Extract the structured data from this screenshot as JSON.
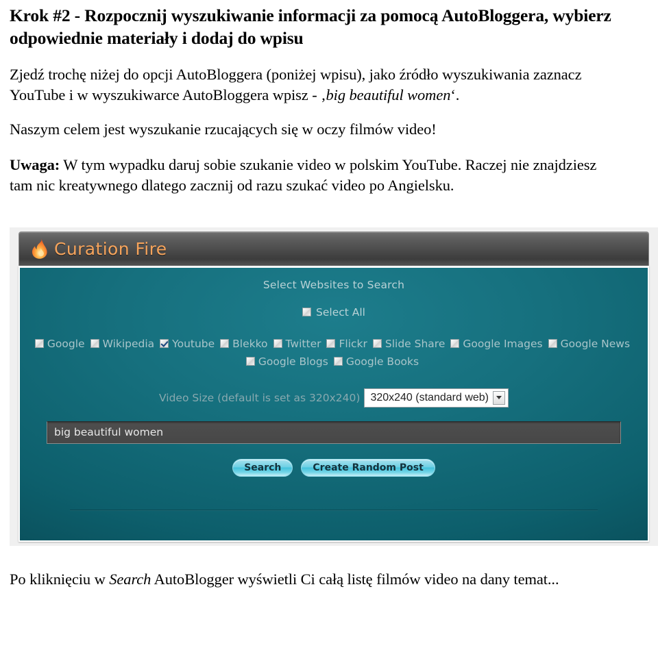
{
  "document": {
    "headline": "Krok #2 - Rozpocznij wyszukiwanie informacji za pomocą AutoBloggera, wybierz odpowiednie materiały i dodaj do wpisu",
    "para1_part1": "Zjedź trochę niżej do opcji AutoBloggera (poniżej wpisu), jako źródło wyszukiwania zaznacz YouTube i w wyszukiwarce AutoBloggera wpisz - ‚",
    "para1_italic": "big beautiful women",
    "para1_part2": "‘.",
    "para2": "Naszym celem jest wyszukanie rzucających się w oczy filmów video!",
    "para3_bold": "Uwaga:",
    "para3_rest": " W tym wypadku daruj sobie szukanie video w polskim YouTube. Raczej nie znajdziesz tam nic kreatywnego dlatego zacznij od razu szukać video po Angielsku.",
    "footer_part1": "Po kliknięciu w ",
    "footer_italic": "Search",
    "footer_part2": " AutoBlogger wyświetli Ci całą listę filmów video na dany temat..."
  },
  "app": {
    "logo_text": "Curation Fire",
    "logo_icon": "flame-icon",
    "panel_title": "Select Websites to Search",
    "select_all_label": "Select All",
    "select_all_checked": false,
    "sites": [
      {
        "label": "Google",
        "checked": false
      },
      {
        "label": "Wikipedia",
        "checked": false
      },
      {
        "label": "Youtube",
        "checked": true
      },
      {
        "label": "Blekko",
        "checked": false
      },
      {
        "label": "Twitter",
        "checked": false
      },
      {
        "label": "Flickr",
        "checked": false
      },
      {
        "label": "Slide Share",
        "checked": false
      },
      {
        "label": "Google Images",
        "checked": false
      },
      {
        "label": "Google News",
        "checked": false
      },
      {
        "label": "Google Blogs",
        "checked": false
      },
      {
        "label": "Google Books",
        "checked": false
      }
    ],
    "video_size_label": "Video Size (default is set as 320x240)",
    "video_size_value": "320x240 (standard web)",
    "video_size_options": [
      "320x240 (standard web)"
    ],
    "search_input_value": "big beautiful women",
    "search_input_placeholder": "",
    "search_button_label": "Search",
    "random_post_button_label": "Create Random Post",
    "colors": {
      "panel_teal": "#0d5f6c",
      "titlebar_gray": "#4a4a4a",
      "logo_orange": "#f6a45c",
      "button_cyan": "#45c3dc"
    }
  }
}
